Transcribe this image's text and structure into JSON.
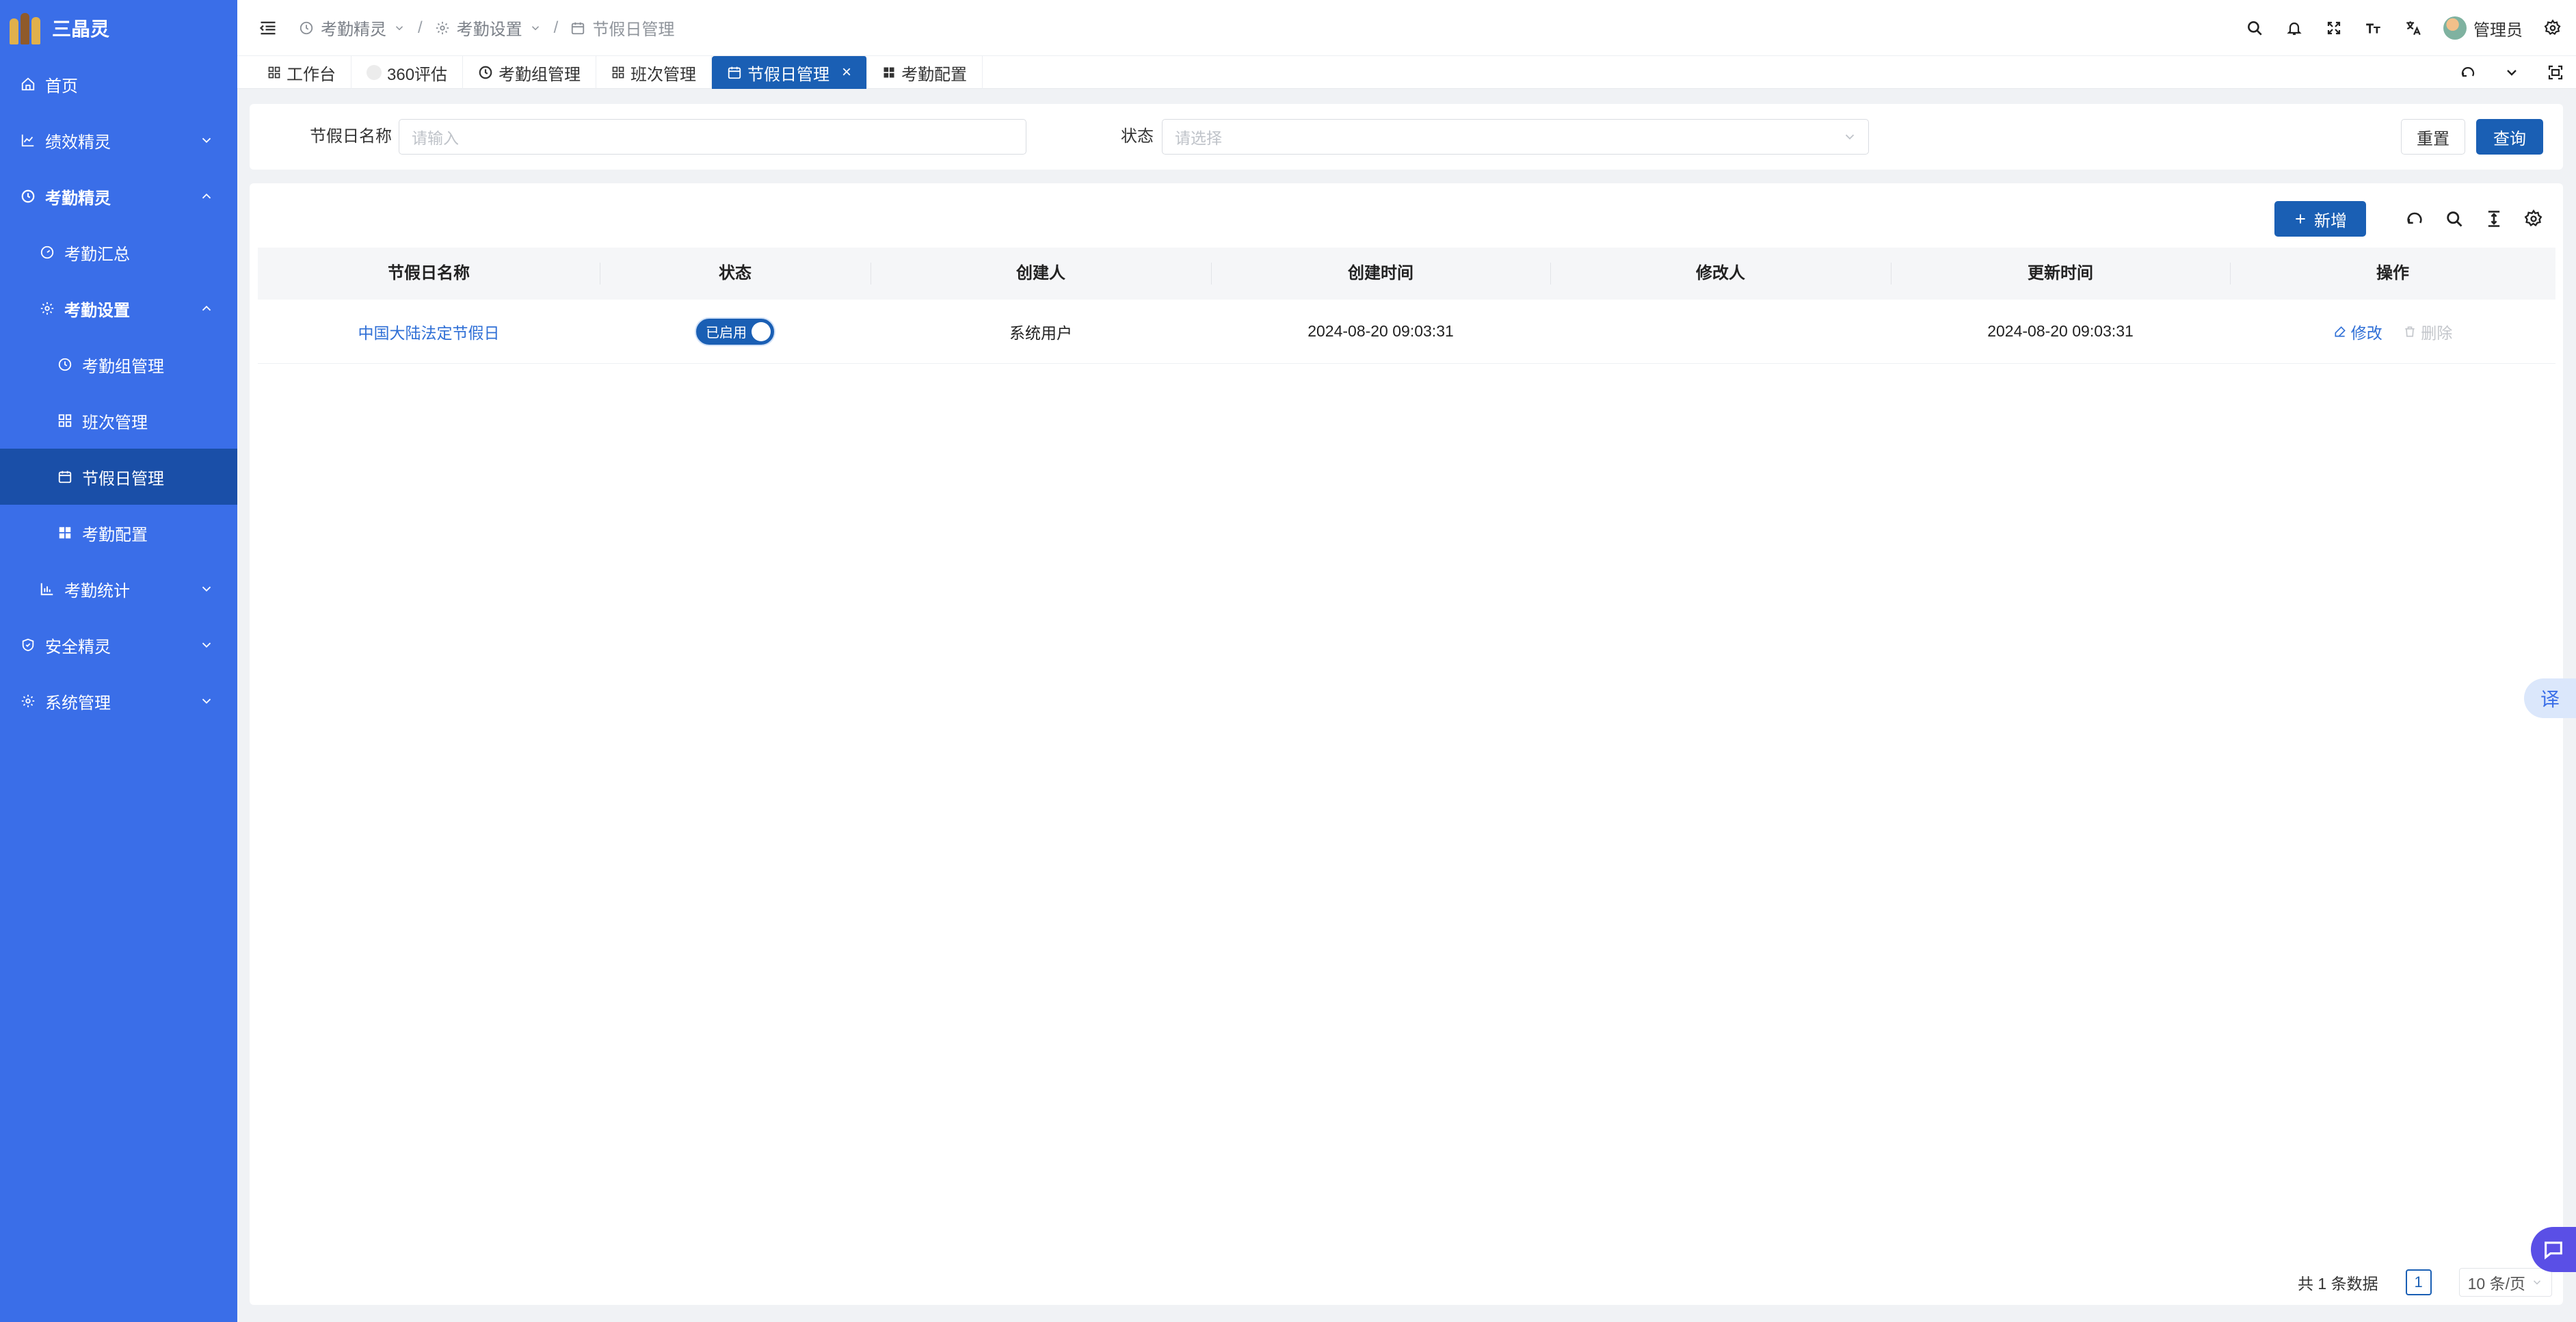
{
  "brand": {
    "name": "三晶灵"
  },
  "sidebar": {
    "items": [
      {
        "label": "首页"
      },
      {
        "label": "绩效精灵"
      },
      {
        "label": "考勤精灵"
      },
      {
        "label": "考勤汇总"
      },
      {
        "label": "考勤设置"
      },
      {
        "label": "考勤组管理"
      },
      {
        "label": "班次管理"
      },
      {
        "label": "节假日管理"
      },
      {
        "label": "考勤配置"
      },
      {
        "label": "考勤统计"
      },
      {
        "label": "安全精灵"
      },
      {
        "label": "系统管理"
      }
    ]
  },
  "breadcrumb": {
    "items": [
      "考勤精灵",
      "考勤设置",
      "节假日管理"
    ],
    "separator": "/"
  },
  "header": {
    "user_name": "管理员"
  },
  "tabs": [
    {
      "label": "工作台"
    },
    {
      "label": "360评估"
    },
    {
      "label": "考勤组管理"
    },
    {
      "label": "班次管理"
    },
    {
      "label": "节假日管理",
      "close": "×"
    },
    {
      "label": "考勤配置"
    }
  ],
  "search": {
    "name_label": "节假日名称",
    "name_placeholder": "请输入",
    "status_label": "状态",
    "status_placeholder": "请选择",
    "reset_label": "重置",
    "query_label": "查询"
  },
  "toolbar": {
    "add_label": "新增"
  },
  "table": {
    "columns": [
      "节假日名称",
      "状态",
      "创建人",
      "创建时间",
      "修改人",
      "更新时间",
      "操作"
    ],
    "rows": [
      {
        "name": "中国大陆法定节假日",
        "status": "已启用",
        "creator": "系统用户",
        "created_at": "2024-08-20 09:03:31",
        "modifier": "",
        "updated_at": "2024-08-20 09:03:31",
        "edit": "修改",
        "delete": "删除"
      }
    ]
  },
  "pagination": {
    "total_text": "共 1 条数据",
    "current_page": "1",
    "page_size": "10 条/页"
  },
  "floating": {
    "translate": "译"
  },
  "colors": {
    "sidebar_bg": "#3a6ee8",
    "sidebar_active": "#1a4fa8",
    "primary": "#1a5fb4",
    "link": "#2f6fd6"
  }
}
